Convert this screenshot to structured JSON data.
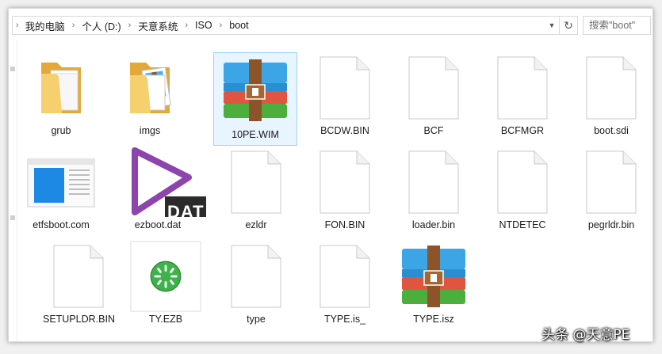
{
  "breadcrumb": {
    "items": [
      "我的电脑",
      "个人 (D:)",
      "天意系统",
      "ISO",
      "boot"
    ]
  },
  "search": {
    "placeholder": "搜索\"boot\""
  },
  "files": [
    {
      "name": "grub",
      "icon": "folder-icon"
    },
    {
      "name": "imgs",
      "icon": "folder-images-icon"
    },
    {
      "name": "10PE.WIM",
      "icon": "winrar-archive-icon",
      "selected": true
    },
    {
      "name": "BCDW.BIN",
      "icon": "blank-file-icon"
    },
    {
      "name": "BCF",
      "icon": "blank-file-icon"
    },
    {
      "name": "BCFMGR",
      "icon": "blank-file-icon"
    },
    {
      "name": "boot.sdi",
      "icon": "blank-file-icon"
    },
    {
      "name": "etfsboot.com",
      "icon": "application-window-icon"
    },
    {
      "name": "ezboot.dat",
      "icon": "dat-play-icon",
      "badge": "DAT"
    },
    {
      "name": "ezldr",
      "icon": "blank-file-icon"
    },
    {
      "name": "FON.BIN",
      "icon": "blank-file-icon"
    },
    {
      "name": "loader.bin",
      "icon": "blank-file-icon"
    },
    {
      "name": "NTDETEC",
      "icon": "blank-file-icon"
    },
    {
      "name": "pegrldr.bin",
      "icon": "blank-file-icon"
    },
    {
      "name": "SETUPLDR.BIN",
      "icon": "blank-file-icon"
    },
    {
      "name": "TY.EZB",
      "icon": "loading-spinner-icon"
    },
    {
      "name": "type",
      "icon": "blank-file-icon"
    },
    {
      "name": "TYPE.is_",
      "icon": "blank-file-icon"
    },
    {
      "name": "TYPE.isz",
      "icon": "winrar-archive-icon"
    }
  ],
  "watermark": "头条 @天意PE",
  "colors": {
    "selection_border": "#99d1ff",
    "folder": "#f4c864",
    "dat_purple": "#8e44ad"
  }
}
